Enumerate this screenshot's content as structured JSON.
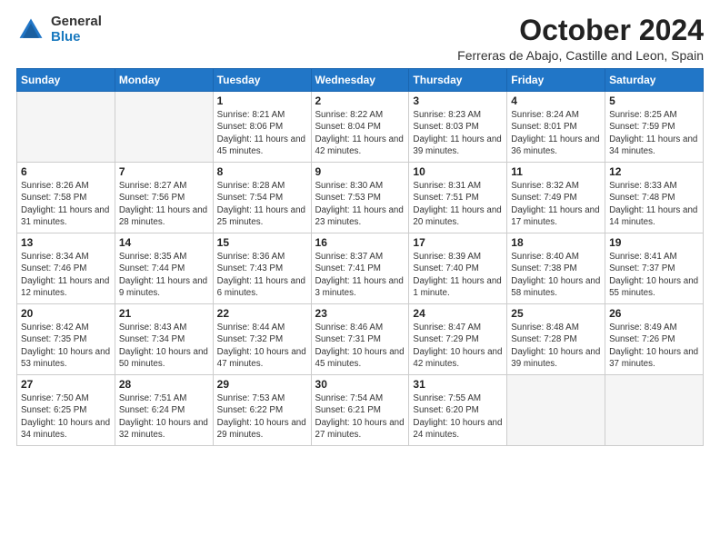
{
  "logo": {
    "general": "General",
    "blue": "Blue"
  },
  "header": {
    "month_title": "October 2024",
    "location": "Ferreras de Abajo, Castille and Leon, Spain"
  },
  "weekdays": [
    "Sunday",
    "Monday",
    "Tuesday",
    "Wednesday",
    "Thursday",
    "Friday",
    "Saturday"
  ],
  "weeks": [
    [
      {
        "day": "",
        "info": ""
      },
      {
        "day": "",
        "info": ""
      },
      {
        "day": "1",
        "info": "Sunrise: 8:21 AM\nSunset: 8:06 PM\nDaylight: 11 hours and 45 minutes."
      },
      {
        "day": "2",
        "info": "Sunrise: 8:22 AM\nSunset: 8:04 PM\nDaylight: 11 hours and 42 minutes."
      },
      {
        "day": "3",
        "info": "Sunrise: 8:23 AM\nSunset: 8:03 PM\nDaylight: 11 hours and 39 minutes."
      },
      {
        "day": "4",
        "info": "Sunrise: 8:24 AM\nSunset: 8:01 PM\nDaylight: 11 hours and 36 minutes."
      },
      {
        "day": "5",
        "info": "Sunrise: 8:25 AM\nSunset: 7:59 PM\nDaylight: 11 hours and 34 minutes."
      }
    ],
    [
      {
        "day": "6",
        "info": "Sunrise: 8:26 AM\nSunset: 7:58 PM\nDaylight: 11 hours and 31 minutes."
      },
      {
        "day": "7",
        "info": "Sunrise: 8:27 AM\nSunset: 7:56 PM\nDaylight: 11 hours and 28 minutes."
      },
      {
        "day": "8",
        "info": "Sunrise: 8:28 AM\nSunset: 7:54 PM\nDaylight: 11 hours and 25 minutes."
      },
      {
        "day": "9",
        "info": "Sunrise: 8:30 AM\nSunset: 7:53 PM\nDaylight: 11 hours and 23 minutes."
      },
      {
        "day": "10",
        "info": "Sunrise: 8:31 AM\nSunset: 7:51 PM\nDaylight: 11 hours and 20 minutes."
      },
      {
        "day": "11",
        "info": "Sunrise: 8:32 AM\nSunset: 7:49 PM\nDaylight: 11 hours and 17 minutes."
      },
      {
        "day": "12",
        "info": "Sunrise: 8:33 AM\nSunset: 7:48 PM\nDaylight: 11 hours and 14 minutes."
      }
    ],
    [
      {
        "day": "13",
        "info": "Sunrise: 8:34 AM\nSunset: 7:46 PM\nDaylight: 11 hours and 12 minutes."
      },
      {
        "day": "14",
        "info": "Sunrise: 8:35 AM\nSunset: 7:44 PM\nDaylight: 11 hours and 9 minutes."
      },
      {
        "day": "15",
        "info": "Sunrise: 8:36 AM\nSunset: 7:43 PM\nDaylight: 11 hours and 6 minutes."
      },
      {
        "day": "16",
        "info": "Sunrise: 8:37 AM\nSunset: 7:41 PM\nDaylight: 11 hours and 3 minutes."
      },
      {
        "day": "17",
        "info": "Sunrise: 8:39 AM\nSunset: 7:40 PM\nDaylight: 11 hours and 1 minute."
      },
      {
        "day": "18",
        "info": "Sunrise: 8:40 AM\nSunset: 7:38 PM\nDaylight: 10 hours and 58 minutes."
      },
      {
        "day": "19",
        "info": "Sunrise: 8:41 AM\nSunset: 7:37 PM\nDaylight: 10 hours and 55 minutes."
      }
    ],
    [
      {
        "day": "20",
        "info": "Sunrise: 8:42 AM\nSunset: 7:35 PM\nDaylight: 10 hours and 53 minutes."
      },
      {
        "day": "21",
        "info": "Sunrise: 8:43 AM\nSunset: 7:34 PM\nDaylight: 10 hours and 50 minutes."
      },
      {
        "day": "22",
        "info": "Sunrise: 8:44 AM\nSunset: 7:32 PM\nDaylight: 10 hours and 47 minutes."
      },
      {
        "day": "23",
        "info": "Sunrise: 8:46 AM\nSunset: 7:31 PM\nDaylight: 10 hours and 45 minutes."
      },
      {
        "day": "24",
        "info": "Sunrise: 8:47 AM\nSunset: 7:29 PM\nDaylight: 10 hours and 42 minutes."
      },
      {
        "day": "25",
        "info": "Sunrise: 8:48 AM\nSunset: 7:28 PM\nDaylight: 10 hours and 39 minutes."
      },
      {
        "day": "26",
        "info": "Sunrise: 8:49 AM\nSunset: 7:26 PM\nDaylight: 10 hours and 37 minutes."
      }
    ],
    [
      {
        "day": "27",
        "info": "Sunrise: 7:50 AM\nSunset: 6:25 PM\nDaylight: 10 hours and 34 minutes."
      },
      {
        "day": "28",
        "info": "Sunrise: 7:51 AM\nSunset: 6:24 PM\nDaylight: 10 hours and 32 minutes."
      },
      {
        "day": "29",
        "info": "Sunrise: 7:53 AM\nSunset: 6:22 PM\nDaylight: 10 hours and 29 minutes."
      },
      {
        "day": "30",
        "info": "Sunrise: 7:54 AM\nSunset: 6:21 PM\nDaylight: 10 hours and 27 minutes."
      },
      {
        "day": "31",
        "info": "Sunrise: 7:55 AM\nSunset: 6:20 PM\nDaylight: 10 hours and 24 minutes."
      },
      {
        "day": "",
        "info": ""
      },
      {
        "day": "",
        "info": ""
      }
    ]
  ]
}
